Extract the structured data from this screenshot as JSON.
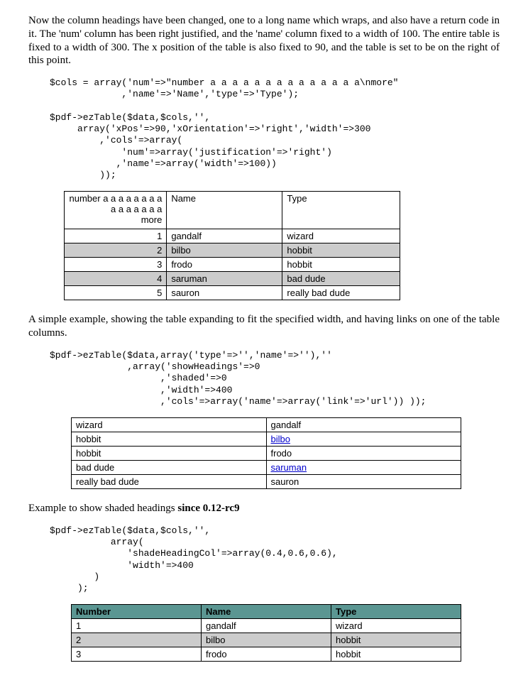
{
  "para1": "Now the column headings have been changed, one to a long name which wraps, and also have a return code in it. The 'num' column has been right justified, and the 'name' column fixed to a width of 100. The entire table is fixed to a width of 300. The x position of the table is also fixed to 90, and the table is set to be on the right of this point.",
  "code1": "$cols = array('num'=>\"number a a a a a a a a a a a a a a\\nmore\"\n             ,'name'=>'Name','type'=>'Type');\n\n$pdf->ezTable($data,$cols,'',\n     array('xPos'=>90,'xOrientation'=>'right','width'=>300\n         ,'cols'=>array(\n             'num'=>array('justification'=>'right')\n            ,'name'=>array('width'=>100))\n         ));",
  "table1": {
    "header": {
      "num": "number a a a a a a a a\na a a a a a a\nmore",
      "name": "Name",
      "type": "Type"
    },
    "rows": [
      {
        "num": "1",
        "name": "gandalf",
        "type": "wizard"
      },
      {
        "num": "2",
        "name": "bilbo",
        "type": "hobbit"
      },
      {
        "num": "3",
        "name": "frodo",
        "type": "hobbit"
      },
      {
        "num": "4",
        "name": "saruman",
        "type": "bad dude"
      },
      {
        "num": "5",
        "name": "sauron",
        "type": "really bad dude"
      }
    ]
  },
  "para2": "A simple example, showing the table expanding to fit the specified width, and having links on one of the table columns.",
  "code2": "$pdf->ezTable($data,array('type'=>'','name'=>''),''\n              ,array('showHeadings'=>0\n                    ,'shaded'=>0\n                    ,'width'=>400\n                    ,'cols'=>array('name'=>array('link'=>'url')) ));",
  "table2": {
    "rows": [
      {
        "type": "wizard",
        "name": "gandalf",
        "link": false
      },
      {
        "type": "hobbit",
        "name": "bilbo",
        "link": true
      },
      {
        "type": "hobbit",
        "name": "frodo",
        "link": false
      },
      {
        "type": "bad dude",
        "name": "saruman",
        "link": true
      },
      {
        "type": "really bad dude",
        "name": "sauron",
        "link": false
      }
    ]
  },
  "para3_a": "Example to show shaded headings ",
  "para3_b": "since 0.12-rc9",
  "code3": "$pdf->ezTable($data,$cols,'',\n           array(\n              'shadeHeadingCol'=>array(0.4,0.6,0.6),\n              'width'=>400\n        )\n     );",
  "table3": {
    "header": {
      "num": "Number",
      "name": "Name",
      "type": "Type"
    },
    "heading_color": "#5b9692",
    "rows": [
      {
        "num": "1",
        "name": "gandalf",
        "type": "wizard"
      },
      {
        "num": "2",
        "name": "bilbo",
        "type": "hobbit"
      },
      {
        "num": "3",
        "name": "frodo",
        "type": "hobbit"
      }
    ]
  }
}
